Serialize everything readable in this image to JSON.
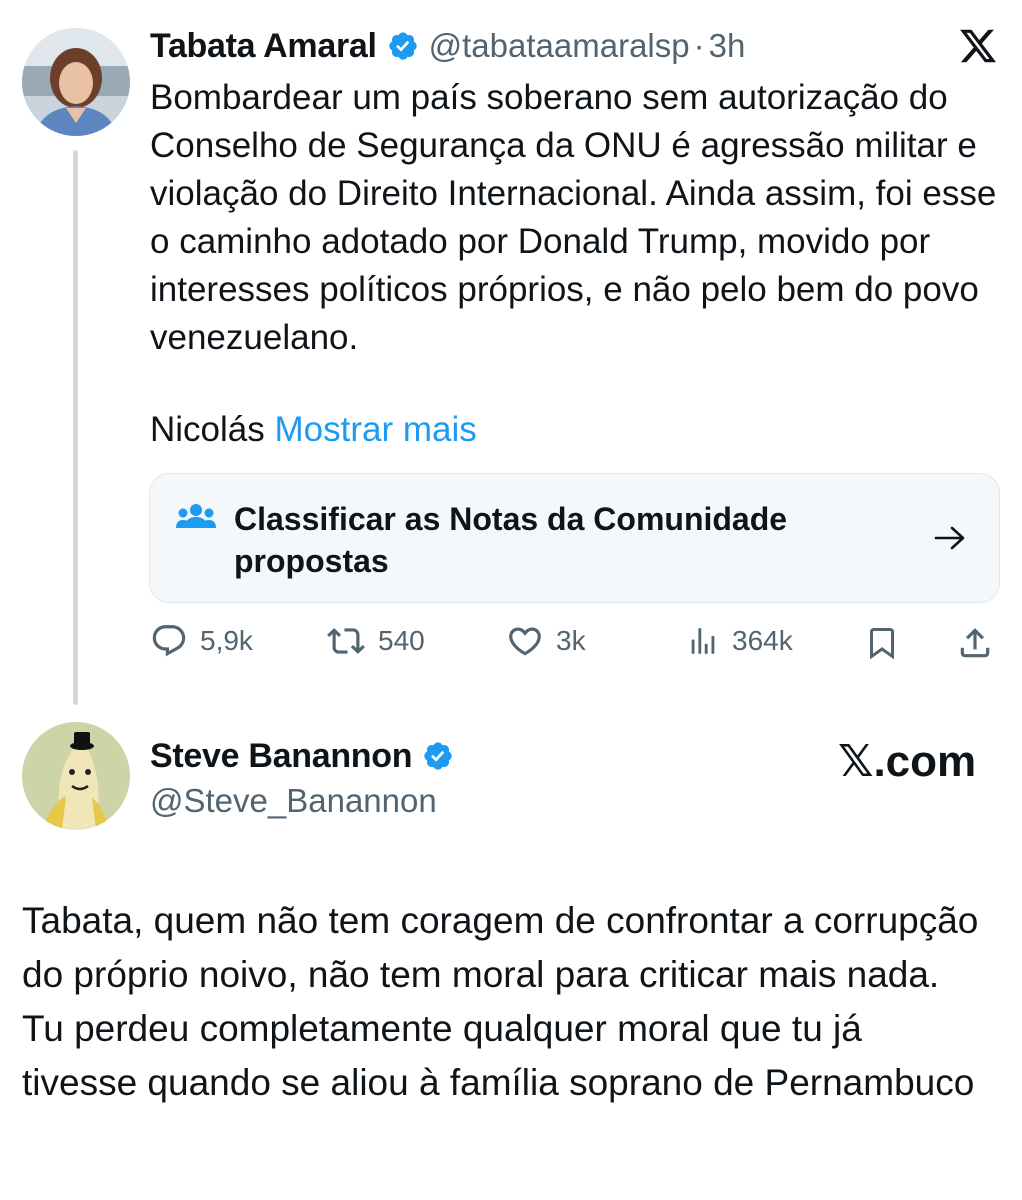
{
  "tweet": {
    "author_name": "Tabata Amaral",
    "author_handle": "@tabataamaralsp",
    "separator": "·",
    "time": "3h",
    "verified_icon": "verified-badge-icon",
    "platform_icon": "x-logo-icon",
    "text": "Bombardear um país soberano sem autorização do Conselho de Segurança da ONU é agressão militar e violação do Direito Internacional. Ainda assim, foi esse o caminho adotado por Donald Trump, movido por interesses políticos próprios, e não pelo bem do povo venezuelano.",
    "truncated_word": "Nicolás",
    "show_more": "Mostrar mais",
    "community_notes": {
      "icon": "community-icon",
      "label": "Classificar as Notas da Comunidade propostas",
      "arrow_icon": "arrow-right-icon"
    },
    "actions": {
      "replies": "5,9k",
      "retweets": "540",
      "likes": "3k",
      "views": "364k"
    }
  },
  "reply": {
    "author_name": "Steve Banannon",
    "author_handle": "@Steve_Banannon",
    "verified_icon": "verified-badge-icon",
    "watermark": "𝕏.com",
    "text": "Tabata, quem não tem coragem de confrontar a corrupção do próprio noivo, não tem moral para criticar mais nada. Tu perdeu completamente qualquer moral que tu já tivesse quando se aliou à família soprano de Pernambuco"
  },
  "colors": {
    "link_blue": "#1d9bf0",
    "verified_blue": "#1d9bf0",
    "secondary_text": "#536471",
    "thread_line": "#cfd9de"
  }
}
